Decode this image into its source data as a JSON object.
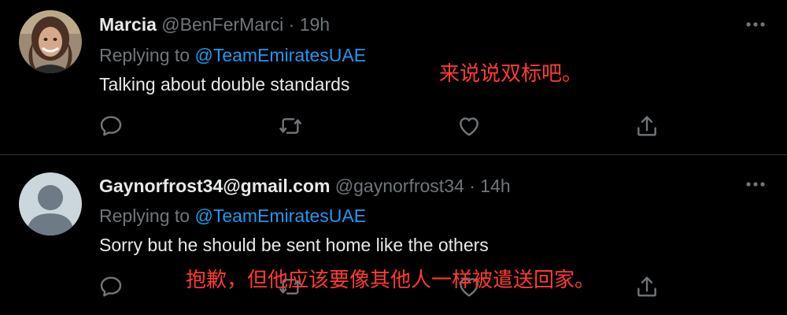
{
  "colors": {
    "background": "#000000",
    "text_primary": "#e7e9ea",
    "text_secondary": "#71767b",
    "mention": "#1d9bf0",
    "caption_red": "#ff3b30"
  },
  "tweets": [
    {
      "display_name": "Marcia",
      "handle": "@BenFerMarci",
      "separator": "·",
      "time": "19h",
      "replying_label": "Replying to",
      "reply_to": "@TeamEmiratesUAE",
      "text": "Talking about double standards",
      "avatar": "profile-photo",
      "actions": [
        "reply-icon",
        "retweet-icon",
        "like-icon",
        "share-icon"
      ]
    },
    {
      "display_name": "Gaynorfrost34@gmail.com",
      "handle": "@gaynorfrost34",
      "separator": "·",
      "time": "14h",
      "replying_label": "Replying to",
      "reply_to": "@TeamEmiratesUAE",
      "text": "Sorry but he should be sent home like the others",
      "avatar": "default-avatar",
      "actions": [
        "reply-icon",
        "retweet-icon",
        "like-icon",
        "share-icon"
      ]
    }
  ],
  "captions": [
    "来说说双标吧。",
    "抱歉，但他应该要像其他人一样被遣送回家。"
  ]
}
